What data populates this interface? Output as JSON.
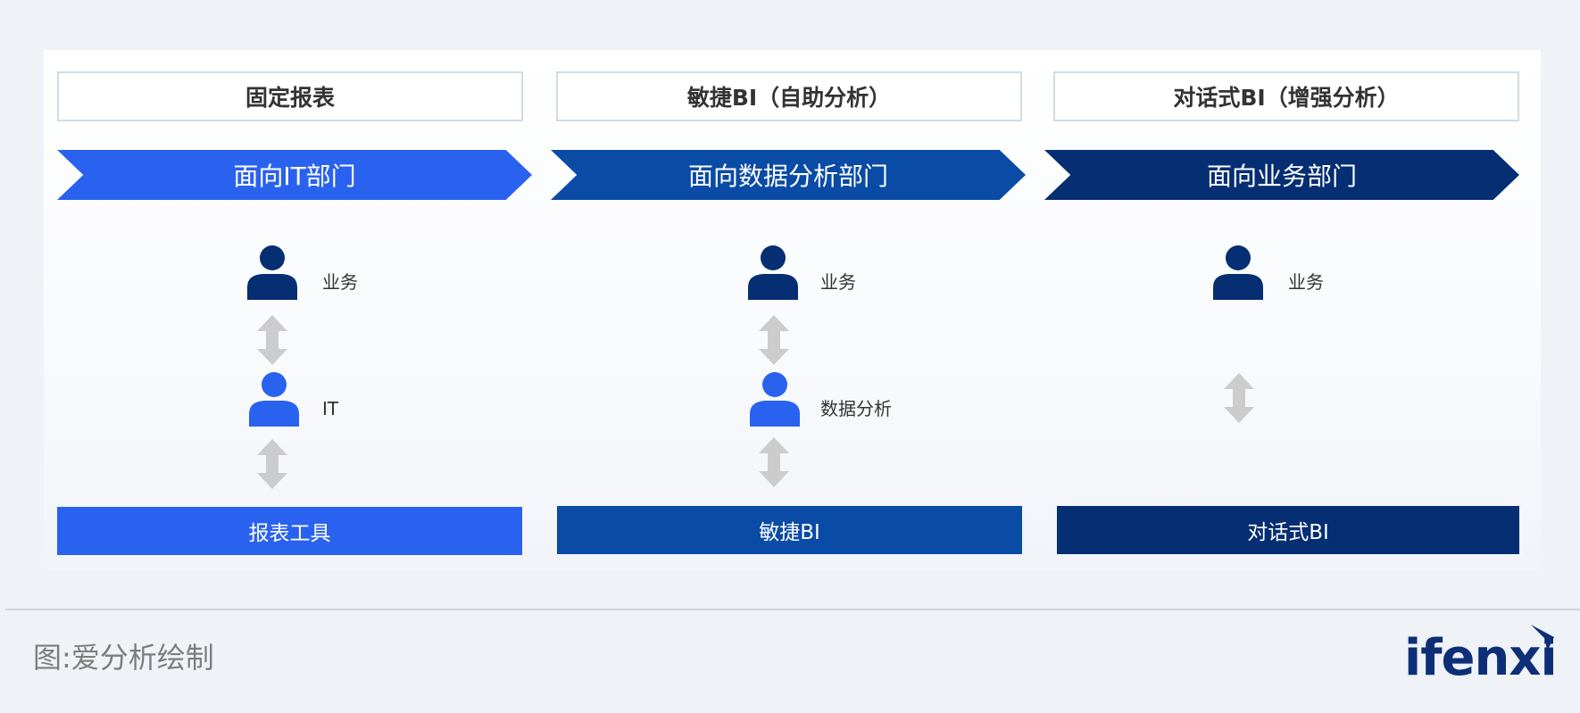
{
  "columns": [
    {
      "title": "固定报表",
      "audience": "面向IT部门",
      "bottom": "报表工具",
      "roles": [
        "业务",
        "IT"
      ],
      "color": "#2a62f0"
    },
    {
      "title": "敏捷BI（自助分析）",
      "audience": "面向数据分析部门",
      "bottom": "敏捷BI",
      "roles": [
        "业务",
        "数据分析"
      ],
      "color": "#0a4ba6"
    },
    {
      "title": "对话式BI（增强分析）",
      "audience": "面向业务部门",
      "bottom": "对话式BI",
      "roles": [
        "业务"
      ],
      "color": "#052e73"
    }
  ],
  "colors": {
    "person_business": "#062e73",
    "person_it": "#2a62f0",
    "arrow": "#cccccc",
    "background": "#eff2f6"
  },
  "footer": {
    "source": "图:爱分析绘制",
    "logo_text": "ifenxi"
  }
}
